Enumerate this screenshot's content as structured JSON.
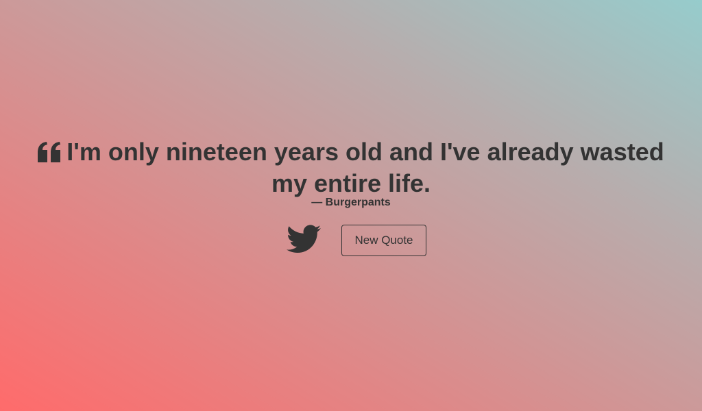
{
  "quote": {
    "text": "I'm only nineteen years old and I've already wasted my entire life.",
    "author": "— Burgerpants",
    "icon": "quote-left-icon"
  },
  "actions": {
    "tweet_icon": "twitter-icon",
    "new_quote_label": "New Quote"
  },
  "colors": {
    "text": "#333333",
    "gradient_start": "#ff6b6b",
    "gradient_end": "#96cccc"
  }
}
